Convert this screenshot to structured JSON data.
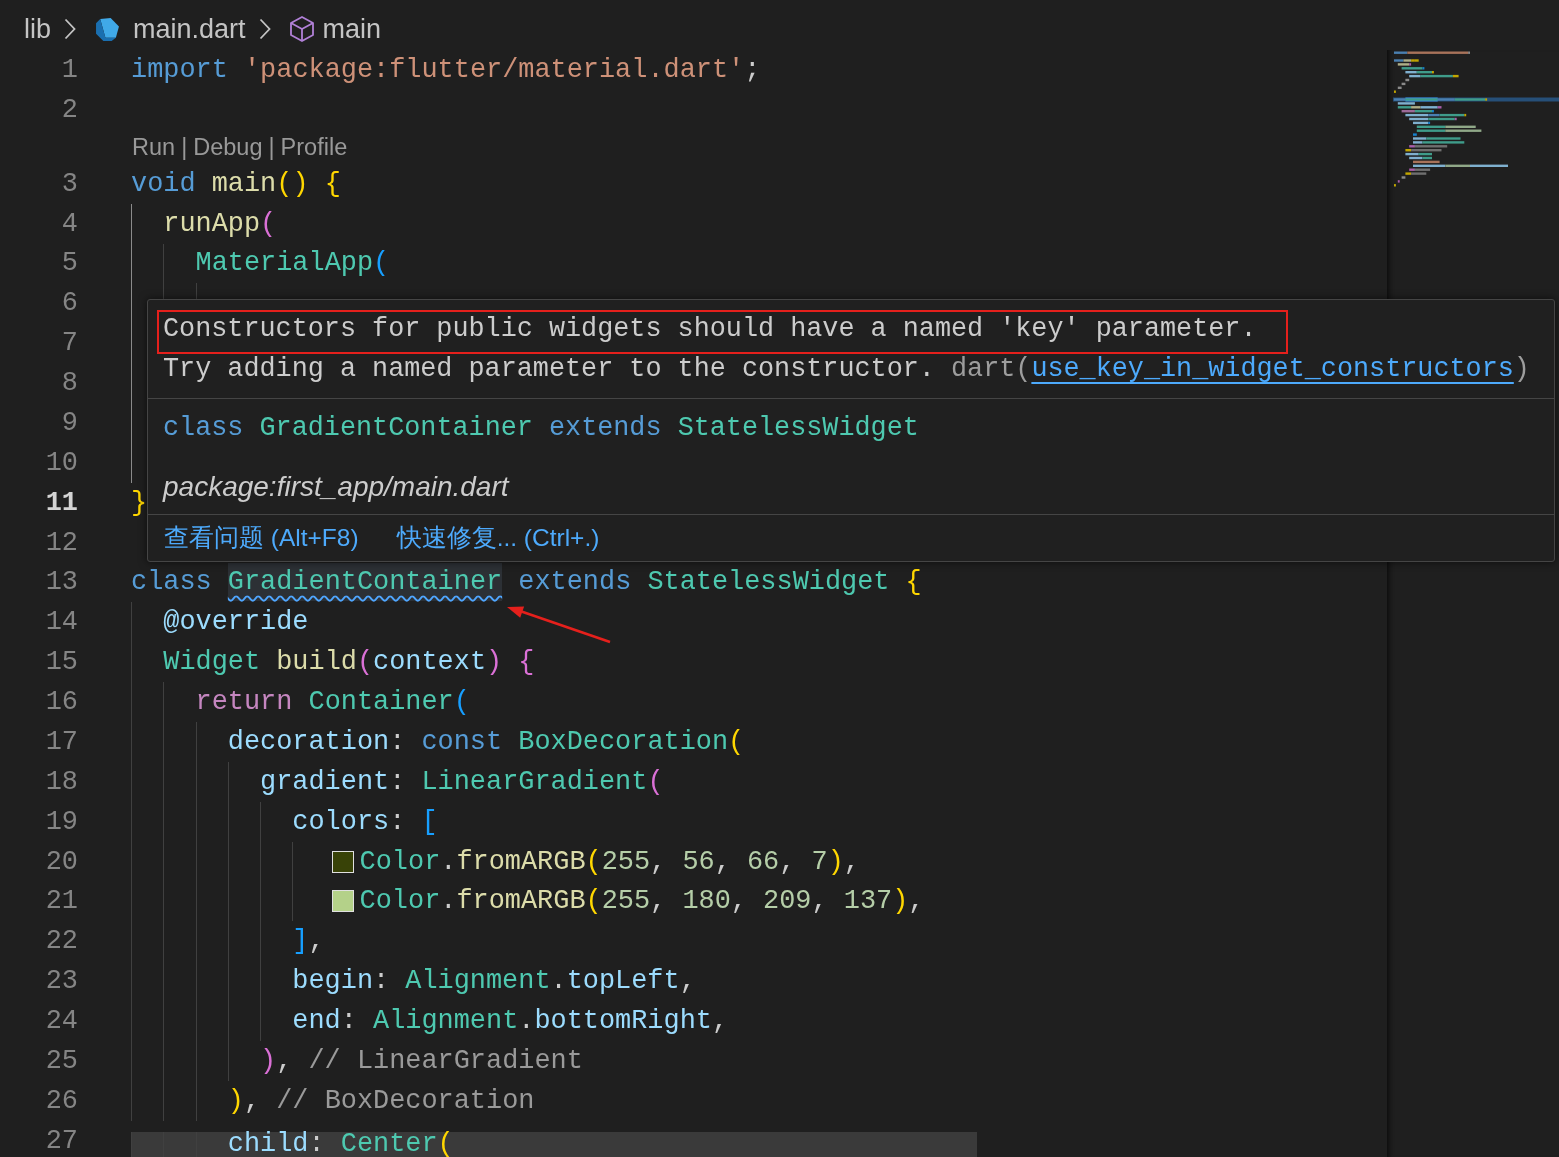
{
  "breadcrumbs": [
    {
      "label": "lib",
      "kind": "folder"
    },
    {
      "label": "main.dart",
      "kind": "file"
    },
    {
      "label": "main",
      "kind": "function"
    }
  ],
  "editor": {
    "lines": [
      {
        "kind": "code",
        "number": "1",
        "current": false,
        "highlighted": false,
        "active_block": false,
        "tokens": [
          {
            "text": "import ",
            "kind": "keyword"
          },
          {
            "text": "'package:flutter/material.dart'",
            "kind": "string"
          },
          {
            "text": ";",
            "kind": "plain"
          }
        ]
      },
      {
        "kind": "code",
        "number": "2",
        "current": false,
        "highlighted": false,
        "active_block": false
      },
      {
        "kind": "code_lens",
        "actions": [
          "Run",
          "Debug",
          "Profile"
        ],
        "separator": "|"
      },
      {
        "kind": "code",
        "number": "3",
        "current": false,
        "highlighted": false,
        "active_block": true,
        "tokens": [
          {
            "text": "void ",
            "kind": "keyword"
          },
          {
            "text": "main",
            "kind": "function"
          },
          {
            "text": "() {",
            "kind": "bracket1"
          }
        ],
        "children": [
          {
            "kind": "code",
            "number": "4",
            "current": false,
            "highlighted": false,
            "active_block": false,
            "tokens": [
              {
                "text": "runApp",
                "kind": "function"
              },
              {
                "text": "(",
                "kind": "bracket2"
              }
            ],
            "children": [
              {
                "kind": "code",
                "number": "5",
                "current": false,
                "highlighted": false,
                "active_block": false,
                "tokens": [
                  {
                    "text": "MaterialApp",
                    "kind": "type"
                  },
                  {
                    "text": "(",
                    "kind": "bracket3"
                  }
                ],
                "children": [
                  {
                    "kind": "code",
                    "number": "6",
                    "current": false,
                    "highlighted": false,
                    "active_block": false,
                    "children": [
                      {
                        "kind": "code",
                        "number": "7",
                        "current": false,
                        "highlighted": false,
                        "active_block": false
                      }
                    ]
                  },
                  {
                    "kind": "code",
                    "number": "8",
                    "current": false,
                    "highlighted": false,
                    "active_block": false
                  }
                ]
              },
              {
                "kind": "code",
                "number": "9",
                "current": false,
                "highlighted": false,
                "active_block": false
              }
            ]
          },
          {
            "kind": "code",
            "number": "10",
            "current": false,
            "highlighted": false,
            "active_block": false
          }
        ]
      },
      {
        "kind": "code",
        "number": "11",
        "current": true,
        "highlighted": false,
        "active_block": false,
        "tokens": [
          {
            "text": "}",
            "kind": "bracket1"
          }
        ]
      },
      {
        "kind": "code",
        "number": "12",
        "current": false,
        "highlighted": false,
        "active_block": false
      },
      {
        "kind": "code",
        "number": "13",
        "current": false,
        "highlighted": false,
        "active_block": false,
        "tokens": [
          {
            "text": "class ",
            "kind": "keyword"
          },
          {
            "text": "GradientContainer",
            "kind": "flagged"
          },
          {
            "text": " extends ",
            "kind": "keyword"
          },
          {
            "text": "StatelessWidget ",
            "kind": "type"
          },
          {
            "text": "{",
            "kind": "bracket1"
          }
        ],
        "children": [
          {
            "kind": "code",
            "number": "14",
            "current": false,
            "highlighted": false,
            "active_block": false,
            "tokens": [
              {
                "text": "@override",
                "kind": "variable"
              }
            ]
          },
          {
            "kind": "code",
            "number": "15",
            "current": false,
            "highlighted": false,
            "active_block": false,
            "tokens": [
              {
                "text": "Widget ",
                "kind": "type"
              },
              {
                "text": "build",
                "kind": "function"
              },
              {
                "text": "(",
                "kind": "bracket2"
              },
              {
                "text": "context",
                "kind": "variable"
              },
              {
                "text": ") {",
                "kind": "bracket2"
              }
            ],
            "children": [
              {
                "kind": "code",
                "number": "16",
                "current": false,
                "highlighted": false,
                "active_block": false,
                "tokens": [
                  {
                    "text": "return ",
                    "kind": "control"
                  },
                  {
                    "text": "Container",
                    "kind": "type"
                  },
                  {
                    "text": "(",
                    "kind": "bracket3"
                  }
                ],
                "children": [
                  {
                    "kind": "code",
                    "number": "17",
                    "current": false,
                    "highlighted": false,
                    "active_block": false,
                    "tokens": [
                      {
                        "text": "decoration",
                        "kind": "variable"
                      },
                      {
                        "text": ": ",
                        "kind": "plain"
                      },
                      {
                        "text": "const ",
                        "kind": "keyword"
                      },
                      {
                        "text": "BoxDecoration",
                        "kind": "type"
                      },
                      {
                        "text": "(",
                        "kind": "bracket1"
                      }
                    ],
                    "children": [
                      {
                        "kind": "code",
                        "number": "18",
                        "current": false,
                        "highlighted": false,
                        "active_block": false,
                        "tokens": [
                          {
                            "text": "gradient",
                            "kind": "variable"
                          },
                          {
                            "text": ": ",
                            "kind": "plain"
                          },
                          {
                            "text": "LinearGradient",
                            "kind": "type"
                          },
                          {
                            "text": "(",
                            "kind": "bracket2"
                          }
                        ],
                        "children": [
                          {
                            "kind": "code",
                            "number": "19",
                            "current": false,
                            "highlighted": false,
                            "active_block": false,
                            "tokens": [
                              {
                                "text": "colors",
                                "kind": "variable"
                              },
                              {
                                "text": ": ",
                                "kind": "plain"
                              },
                              {
                                "text": "[",
                                "kind": "bracket3"
                              }
                            ],
                            "children": [
                              {
                                "kind": "code",
                                "number": "20",
                                "current": false,
                                "highlighted": false,
                                "active_block": false,
                                "tokens": [
                                  {
                                    "kind": "swatch",
                                    "color": "#384207"
                                  },
                                  {
                                    "text": "Color",
                                    "kind": "type"
                                  },
                                  {
                                    "text": ".",
                                    "kind": "plain"
                                  },
                                  {
                                    "text": "fromARGB",
                                    "kind": "function"
                                  },
                                  {
                                    "text": "(",
                                    "kind": "bracket1"
                                  },
                                  {
                                    "text": "255",
                                    "kind": "number"
                                  },
                                  {
                                    "text": ", ",
                                    "kind": "plain"
                                  },
                                  {
                                    "text": "56",
                                    "kind": "number"
                                  },
                                  {
                                    "text": ", ",
                                    "kind": "plain"
                                  },
                                  {
                                    "text": "66",
                                    "kind": "number"
                                  },
                                  {
                                    "text": ", ",
                                    "kind": "plain"
                                  },
                                  {
                                    "text": "7",
                                    "kind": "number"
                                  },
                                  {
                                    "text": ")",
                                    "kind": "bracket1"
                                  },
                                  {
                                    "text": ",",
                                    "kind": "plain"
                                  }
                                ]
                              },
                              {
                                "kind": "code",
                                "number": "21",
                                "current": false,
                                "highlighted": false,
                                "active_block": false,
                                "tokens": [
                                  {
                                    "kind": "swatch",
                                    "color": "#b4d189"
                                  },
                                  {
                                    "text": "Color",
                                    "kind": "type"
                                  },
                                  {
                                    "text": ".",
                                    "kind": "plain"
                                  },
                                  {
                                    "text": "fromARGB",
                                    "kind": "function"
                                  },
                                  {
                                    "text": "(",
                                    "kind": "bracket1"
                                  },
                                  {
                                    "text": "255",
                                    "kind": "number"
                                  },
                                  {
                                    "text": ", ",
                                    "kind": "plain"
                                  },
                                  {
                                    "text": "180",
                                    "kind": "number"
                                  },
                                  {
                                    "text": ", ",
                                    "kind": "plain"
                                  },
                                  {
                                    "text": "209",
                                    "kind": "number"
                                  },
                                  {
                                    "text": ", ",
                                    "kind": "plain"
                                  },
                                  {
                                    "text": "137",
                                    "kind": "number"
                                  },
                                  {
                                    "text": ")",
                                    "kind": "bracket1"
                                  },
                                  {
                                    "text": ",",
                                    "kind": "plain"
                                  }
                                ]
                              }
                            ]
                          },
                          {
                            "kind": "code",
                            "number": "22",
                            "current": false,
                            "highlighted": false,
                            "active_block": false,
                            "tokens": [
                              {
                                "text": "]",
                                "kind": "bracket3"
                              },
                              {
                                "text": ",",
                                "kind": "plain"
                              }
                            ]
                          },
                          {
                            "kind": "code",
                            "number": "23",
                            "current": false,
                            "highlighted": false,
                            "active_block": false,
                            "tokens": [
                              {
                                "text": "begin",
                                "kind": "variable"
                              },
                              {
                                "text": ": ",
                                "kind": "plain"
                              },
                              {
                                "text": "Alignment",
                                "kind": "type"
                              },
                              {
                                "text": ".",
                                "kind": "plain"
                              },
                              {
                                "text": "topLeft",
                                "kind": "variable"
                              },
                              {
                                "text": ",",
                                "kind": "plain"
                              }
                            ]
                          },
                          {
                            "kind": "code",
                            "number": "24",
                            "current": false,
                            "highlighted": false,
                            "active_block": false,
                            "tokens": [
                              {
                                "text": "end",
                                "kind": "variable"
                              },
                              {
                                "text": ": ",
                                "kind": "plain"
                              },
                              {
                                "text": "Alignment",
                                "kind": "type"
                              },
                              {
                                "text": ".",
                                "kind": "plain"
                              },
                              {
                                "text": "bottomRight",
                                "kind": "variable"
                              },
                              {
                                "text": ",",
                                "kind": "plain"
                              }
                            ]
                          }
                        ]
                      },
                      {
                        "kind": "code",
                        "number": "25",
                        "current": false,
                        "highlighted": false,
                        "active_block": false,
                        "tokens": [
                          {
                            "text": ")",
                            "kind": "bracket2"
                          },
                          {
                            "text": ", ",
                            "kind": "plain"
                          },
                          {
                            "text": "// LinearGradient",
                            "kind": "comment"
                          }
                        ]
                      }
                    ]
                  },
                  {
                    "kind": "code",
                    "number": "26",
                    "current": false,
                    "highlighted": false,
                    "active_block": false,
                    "tokens": [
                      {
                        "text": ")",
                        "kind": "bracket1"
                      },
                      {
                        "text": ", ",
                        "kind": "plain"
                      },
                      {
                        "text": "// BoxDecoration",
                        "kind": "comment"
                      }
                    ]
                  },
                  {
                    "kind": "code",
                    "number": "27",
                    "current": false,
                    "highlighted": true,
                    "active_block": false,
                    "tokens": [
                      {
                        "text": "child",
                        "kind": "variable"
                      },
                      {
                        "text": ": ",
                        "kind": "plain"
                      },
                      {
                        "text": "Center",
                        "kind": "type"
                      },
                      {
                        "text": "(",
                        "kind": "bracket1"
                      }
                    ]
                  }
                ]
              }
            ]
          }
        ]
      }
    ]
  },
  "show_minimap": true,
  "hover": {
    "message": "Constructors for public widgets should have a named 'key' parameter.",
    "message_outlined": true,
    "hint": [
      {
        "text": "Try adding a named parameter to the constructor. ",
        "kind": "plain"
      },
      {
        "text": "dart(",
        "kind": "muted"
      },
      {
        "text": "use_key_in_widget_constructors",
        "kind": "link"
      },
      {
        "text": ")",
        "kind": "muted"
      }
    ],
    "signature": [
      {
        "text": "class ",
        "kind": "keyword"
      },
      {
        "text": "GradientContainer ",
        "kind": "type"
      },
      {
        "text": "extends ",
        "kind": "keyword"
      },
      {
        "text": "StatelessWidget",
        "kind": "type"
      }
    ],
    "source": "package:first_app/main.dart",
    "actions": [
      "查看问题 (Alt+F8)",
      "快速修复... (Ctrl+.)"
    ]
  },
  "pointer_arrow": true
}
